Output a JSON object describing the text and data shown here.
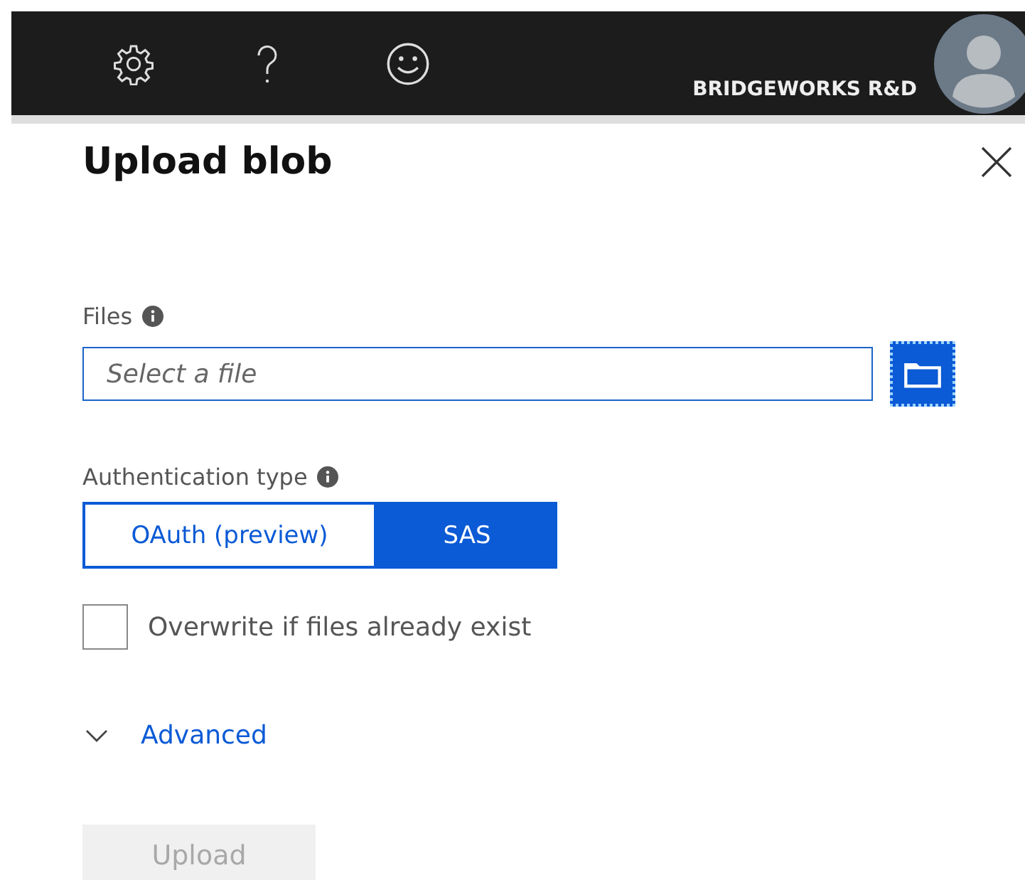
{
  "top_bar": {
    "account": "BRIDGEWORKS R&D"
  },
  "panel": {
    "title": "Upload blob",
    "files": {
      "label": "Files",
      "placeholder": "Select a file"
    },
    "auth": {
      "label": "Authentication type",
      "options": [
        {
          "label": "OAuth (preview)",
          "selected": false
        },
        {
          "label": "SAS",
          "selected": true
        }
      ]
    },
    "overwrite": {
      "label": "Overwrite if files already exist",
      "checked": false
    },
    "advanced": {
      "label": "Advanced",
      "expanded": false
    },
    "upload": {
      "label": "Upload",
      "disabled": true
    }
  }
}
